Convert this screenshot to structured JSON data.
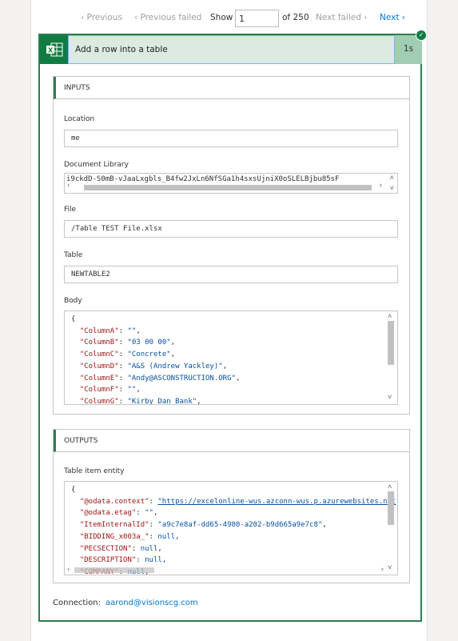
{
  "nav": {
    "previous": "Previous",
    "previous_failed": "Previous failed",
    "show_label": "Show",
    "current_run": "1",
    "of_total": "of 250",
    "next_failed": "Next failed",
    "next": "Next"
  },
  "action": {
    "title": "Add a row into a table",
    "duration": "1s",
    "icon": "excel-icon",
    "status": "succeeded"
  },
  "inputs": {
    "header": "INPUTS",
    "location": {
      "label": "Location",
      "value": "me"
    },
    "document_library": {
      "label": "Document Library",
      "value": "i9ckdD-S0mB-vJaaLxgbls_B4fw2JxLn6NfSGa1h4sxsUjniX0oSLELBjbu85sF"
    },
    "file": {
      "label": "File",
      "value": "/Table TEST File.xlsx"
    },
    "table": {
      "label": "Table",
      "value": "NEWTABLE2"
    },
    "body": {
      "label": "Body",
      "lines": [
        {
          "key": "\"ColumnA\"",
          "value": "\"\""
        },
        {
          "key": "\"ColumnB\"",
          "value": "\"03 00 00\""
        },
        {
          "key": "\"ColumnC\"",
          "value": "\"Concrete\""
        },
        {
          "key": "\"ColumnD\"",
          "value": "\"A&S (Andrew Yackley)\""
        },
        {
          "key": "\"ColumnE\"",
          "value": "\"Andy@ASCONSTRUCTION.ORG\""
        },
        {
          "key": "\"ColumnF\"",
          "value": "\"\""
        },
        {
          "key": "\"ColumnG\"",
          "value": "\"Kirby Dan Bank\""
        }
      ]
    }
  },
  "outputs": {
    "header": "OUTPUTS",
    "entity": {
      "label": "Table item entity",
      "lines": [
        {
          "key": "\"@odata.context\"",
          "value": "\"https://excelonline-wus.azconn-wus.p.azurewebsites.net"
        },
        {
          "key": "\"@odata.etag\"",
          "value": "\"\""
        },
        {
          "key": "\"ItemInternalId\"",
          "value": "\"a9c7e8af-dd65-4980-a202-b9d665a9e7c8\""
        },
        {
          "key": "\"BIDDING_x003a_\"",
          "value": "null"
        },
        {
          "key": "\"PECSECTION\"",
          "value": "null"
        },
        {
          "key": "\"DESCRIPTION\"",
          "value": "null"
        },
        {
          "key": "\"COMPANY\"",
          "value": "null"
        }
      ]
    }
  },
  "connection": {
    "label": "Connection:",
    "value": "aarond@visionscg.com"
  },
  "colors": {
    "accent": "#0078d4",
    "success": "#107c41",
    "header_bg": "#dbeae3"
  }
}
